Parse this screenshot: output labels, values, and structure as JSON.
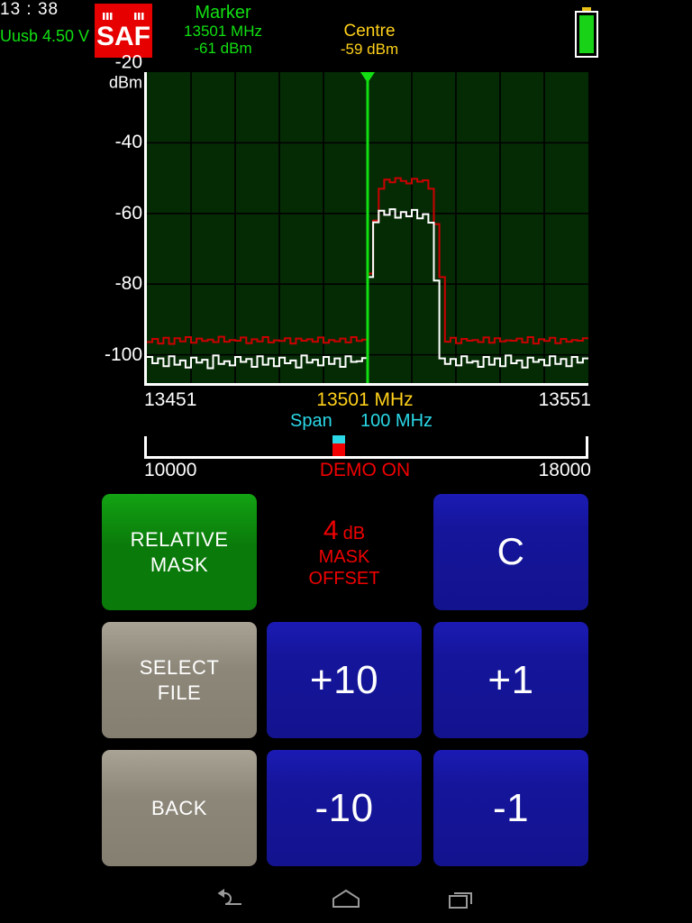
{
  "header": {
    "logo_text": "SAF",
    "logo_color": "#e60000",
    "marker": {
      "title": "Marker",
      "freq": "13501 MHz",
      "level": "-61 dBm",
      "color": "#12e012"
    },
    "centre": {
      "title": "Centre",
      "level": "-59 dBm",
      "color": "#ffd11a"
    },
    "clock": "13 : 38",
    "voltage": "Uusb 4.50 V",
    "battery_icon": "battery-full-icon"
  },
  "chart_data": {
    "type": "line",
    "title": "",
    "xlabel": "MHz",
    "ylabel": "dBm",
    "xlim": [
      13451,
      13551
    ],
    "ylim": [
      -108,
      -20
    ],
    "yticks": [
      -20,
      -40,
      -60,
      -80,
      -100
    ],
    "ytick_labels": [
      "-20",
      "-40",
      "-60",
      "-80",
      "-100"
    ],
    "y_unit": "dBm",
    "grid": true,
    "grid_cols": 10,
    "grid_rows": 4,
    "background": "#052b05",
    "legend": "none",
    "marker_freq": 13501,
    "marker_level": -61,
    "marker_color": "#12e012",
    "series": [
      {
        "name": "mask",
        "color": "#cc0000",
        "noise_floor": -96,
        "peak_level": -50,
        "peak_start": 13492,
        "peak_stop": 13500,
        "values": [
          -96.4,
          -95.5,
          -96.8,
          -95.2,
          -96.9,
          -95.3,
          -96.2,
          -95.0,
          -96.6,
          -95.4,
          -96.1,
          -95.7,
          -96.4,
          -94.9,
          -96.3,
          -95.8,
          -96.0,
          -95.1,
          -96.7,
          -95.6,
          -96.2,
          -95.0,
          -96.5,
          -95.9,
          -96.1,
          -95.3,
          -96.8,
          -95.4,
          -96.0,
          -95.6,
          -96.3,
          -95.1,
          -96.6,
          -95.8,
          -96.2,
          -95.4,
          -96.5,
          -95.0,
          -96.1,
          -95.7,
          -77.0,
          -62.0,
          -53.0,
          -50.4,
          -51.2,
          -50.0,
          -50.8,
          -51.5,
          -50.2,
          -51.0,
          -50.6,
          -53.0,
          -63.0,
          -78.0,
          -96.3,
          -95.2,
          -96.7,
          -95.5,
          -96.0,
          -95.8,
          -96.4,
          -95.1,
          -96.6,
          -95.3,
          -96.2,
          -95.9,
          -96.0,
          -95.4,
          -96.5,
          -95.0,
          -96.8,
          -95.6,
          -96.1,
          -95.2,
          -96.7,
          -95.5,
          -96.3,
          -95.8,
          -96.0,
          -95.3
        ]
      },
      {
        "name": "signal",
        "color": "#ffffff",
        "noise_floor": -101,
        "peak_level": -59,
        "peak_start": 13493,
        "peak_stop": 13499,
        "values": [
          -100.6,
          -102.4,
          -101.0,
          -103.2,
          -100.4,
          -102.8,
          -101.6,
          -103.6,
          -100.8,
          -102.2,
          -101.4,
          -103.8,
          -100.2,
          -102.6,
          -101.8,
          -103.0,
          -100.6,
          -102.0,
          -101.2,
          -103.4,
          -100.4,
          -102.8,
          -101.0,
          -103.2,
          -100.8,
          -102.4,
          -101.6,
          -103.6,
          -100.2,
          -102.2,
          -101.4,
          -103.0,
          -100.6,
          -102.6,
          -101.0,
          -103.4,
          -100.4,
          -102.0,
          -101.8,
          -100.9,
          -78.0,
          -62.5,
          -59.2,
          -60.4,
          -58.8,
          -61.2,
          -59.6,
          -60.8,
          -59.0,
          -61.4,
          -60.2,
          -62.6,
          -79.0,
          -101.0,
          -102.6,
          -101.2,
          -103.0,
          -100.4,
          -102.2,
          -101.8,
          -103.4,
          -100.6,
          -102.8,
          -101.0,
          -103.2,
          -100.2,
          -102.4,
          -101.6,
          -103.6,
          -100.8,
          -102.0,
          -101.4,
          -103.0,
          -100.4,
          -102.6,
          -101.2,
          -103.2,
          -100.6,
          -102.2,
          -101.0
        ]
      }
    ]
  },
  "freq_axis": {
    "start": "13451",
    "centre": "13501 MHz",
    "stop": "13551",
    "centre_color": "#ffd11a"
  },
  "span": {
    "label": "Span",
    "value": "100 MHz",
    "color": "#2ad8e8"
  },
  "range_bar": {
    "start": "10000",
    "stop": "18000",
    "status": "DEMO   ON",
    "status_color": "#f00000",
    "indicator_position_pct": 43.8,
    "indicator_top_color": "#2ad8e8",
    "indicator_bottom_color": "#f00000"
  },
  "keypad": {
    "buttons": [
      {
        "name": "relative-mask-button",
        "line1": "RELATIVE",
        "line2": "MASK",
        "style": "green"
      },
      {
        "name": "c-button",
        "line1": "C",
        "line2": "",
        "style": "blue"
      },
      {
        "name": "select-file-button",
        "line1": "SELECT",
        "line2": "FILE",
        "style": "tan"
      },
      {
        "name": "plus-10-button",
        "line1": "+10",
        "line2": "",
        "style": "blue"
      },
      {
        "name": "plus-1-button",
        "line1": "+1",
        "line2": "",
        "style": "blue"
      },
      {
        "name": "back-button",
        "line1": "BACK",
        "line2": "",
        "style": "tan"
      },
      {
        "name": "minus-10-button",
        "line1": "-10",
        "line2": "",
        "style": "blue"
      },
      {
        "name": "minus-1-button",
        "line1": "-1",
        "line2": "",
        "style": "blue"
      }
    ]
  },
  "mask_offset": {
    "value": "4",
    "unit": "dB",
    "line2": "MASK",
    "line3": "OFFSET",
    "color": "#f00000"
  },
  "navbar": {
    "back": "back-icon",
    "home": "home-icon",
    "recents": "recents-icon"
  }
}
